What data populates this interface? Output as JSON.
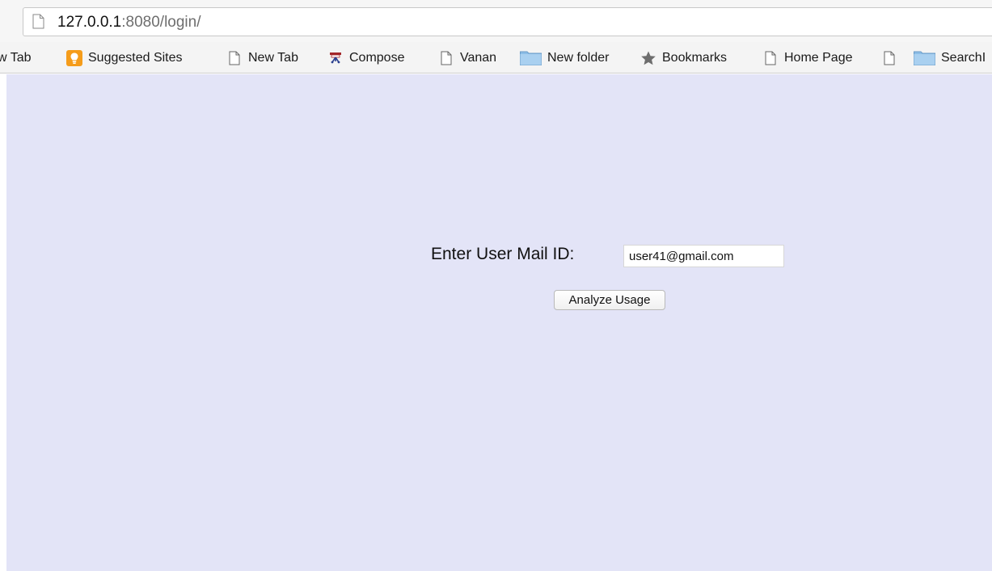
{
  "browser": {
    "url_host": "127.0.0.1",
    "url_rest": ":8080/login/"
  },
  "bookmarks": [
    {
      "label": "w Tab",
      "icon": "page-icon"
    },
    {
      "label": "Suggested Sites",
      "icon": "suggested-sites-icon"
    },
    {
      "label": "New Tab",
      "icon": "page-icon"
    },
    {
      "label": "Compose",
      "icon": "compose-icon"
    },
    {
      "label": "Vanan",
      "icon": "page-icon"
    },
    {
      "label": "New folder",
      "icon": "folder-icon"
    },
    {
      "label": "Bookmarks",
      "icon": "star-icon"
    },
    {
      "label": "Home Page",
      "icon": "page-icon"
    },
    {
      "label": "",
      "icon": "page-icon"
    },
    {
      "label": "SearchI",
      "icon": "folder-icon"
    }
  ],
  "form": {
    "label": "Enter User Mail ID:",
    "email_value": "user41@gmail.com",
    "submit_label": "Analyze Usage"
  },
  "colors": {
    "page_background": "#e3e4f7",
    "bookmark_bar": "#f4f4f4",
    "suggested_sites_icon": "#f59c1a",
    "folder_icon": "#7fb3e0"
  }
}
